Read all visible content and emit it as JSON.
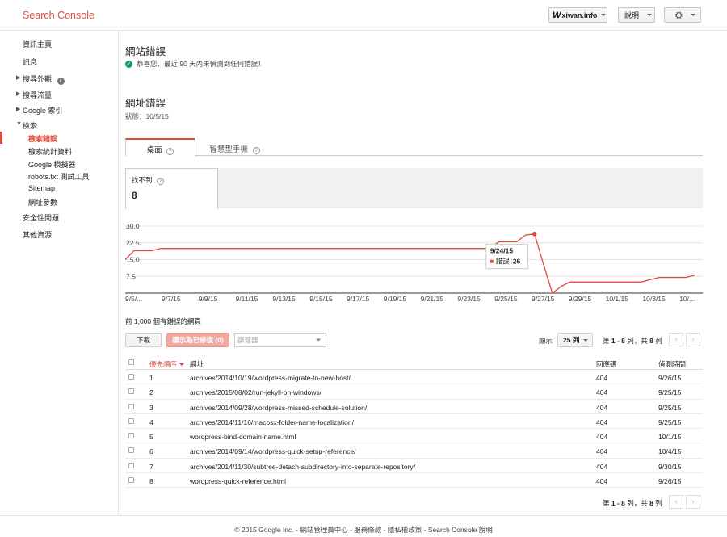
{
  "header": {
    "brand": "Search Console",
    "site": "xiwan.info",
    "site_logo": "W",
    "help": "說明"
  },
  "sidebar": {
    "items": [
      {
        "label": "資訊主頁"
      },
      {
        "label": "訊息"
      },
      {
        "label": "搜尋外觀"
      },
      {
        "label": "搜尋流量"
      },
      {
        "label": "Google 索引"
      },
      {
        "label": "檢索"
      },
      {
        "label": "安全性問題"
      },
      {
        "label": "其他資源"
      }
    ],
    "crawl_sub": [
      {
        "label": "檢索錯誤"
      },
      {
        "label": "檢索統計資料"
      },
      {
        "label": "Google 模擬器"
      },
      {
        "label": "robots.txt 測試工具"
      },
      {
        "label": "Sitemap"
      },
      {
        "label": "網址參數"
      }
    ]
  },
  "site_errors": {
    "title": "網站錯誤",
    "message": "恭喜您，最近 90 天內未偵測到任何錯誤！"
  },
  "url_errors": {
    "title": "網址錯誤",
    "status": "狀態：10/5/15",
    "tabs": [
      {
        "label": "桌面"
      },
      {
        "label": "智慧型手機"
      }
    ],
    "metric_label": "找不到",
    "metric_value": "8"
  },
  "chart_data": {
    "type": "line",
    "color": "#dd4b39",
    "x_labels": [
      "9/5/...",
      "9/7/15",
      "9/9/15",
      "9/11/15",
      "9/13/15",
      "9/15/15",
      "9/17/15",
      "9/19/15",
      "9/21/15",
      "9/23/15",
      "9/25/15",
      "9/27/15",
      "9/29/15",
      "10/1/15",
      "10/3/15",
      "10/..."
    ],
    "y_ticks": [
      "30.0",
      "22.5",
      "15.0",
      "7.5"
    ],
    "ylim": [
      0,
      30
    ],
    "values": [
      15,
      19,
      19,
      19,
      20,
      20,
      20,
      20,
      20,
      20,
      20,
      20,
      20,
      20,
      20,
      20,
      20,
      20,
      20,
      20,
      20,
      20,
      20,
      20,
      20,
      20,
      20,
      20,
      20,
      20,
      20,
      20,
      20,
      20,
      20,
      20,
      20,
      20,
      20,
      20,
      20,
      20,
      23,
      23,
      23,
      26,
      26.5,
      13,
      0,
      3,
      5,
      5,
      5,
      5,
      5,
      5,
      5,
      5,
      5,
      6,
      7,
      7,
      7,
      7,
      8
    ],
    "tooltip": {
      "date": "9/24/15",
      "series": "錯誤：",
      "value": "26"
    }
  },
  "table": {
    "title": "前 1,000 個有錯誤的網頁",
    "download": "下載",
    "mark_fixed": "標示為已修復 (0)",
    "filter_placeholder": "篩選器",
    "show_label": "顯示",
    "rows_per_page": "25 列",
    "page_info_prefix": "第 ",
    "page_range": "1 - 8",
    "page_info_mid": " 列，共 ",
    "page_total": "8",
    "page_info_suffix": " 列",
    "columns": {
      "priority": "優先順序",
      "url": "網址",
      "code": "回應碼",
      "detected": "偵測時間"
    },
    "rows": [
      {
        "priority": "1",
        "url": "archives/2014/10/19/wordpress-migrate-to-new-host/",
        "code": "404",
        "detected": "9/26/15"
      },
      {
        "priority": "2",
        "url": "archives/2015/08/02/run-jekyll-on-windows/",
        "code": "404",
        "detected": "9/25/15"
      },
      {
        "priority": "3",
        "url": "archives/2014/09/28/wordpress-missed-schedule-solution/",
        "code": "404",
        "detected": "9/25/15"
      },
      {
        "priority": "4",
        "url": "archives/2014/11/16/macosx-folder-name-localization/",
        "code": "404",
        "detected": "9/25/15"
      },
      {
        "priority": "5",
        "url": "wordpress-bind-domain-name.html",
        "code": "404",
        "detected": "10/1/15"
      },
      {
        "priority": "6",
        "url": "archives/2014/09/14/wordpress-quick-setup-reference/",
        "code": "404",
        "detected": "10/4/15"
      },
      {
        "priority": "7",
        "url": "archives/2014/11/30/subtree-detach-subdirectory-into-separate-repository/",
        "code": "404",
        "detected": "9/30/15"
      },
      {
        "priority": "8",
        "url": "wordpress-quick-reference.html",
        "code": "404",
        "detected": "9/26/15"
      }
    ]
  },
  "footer": "© 2015 Google Inc. - 網站管理員中心 - 服務條款 - 隱私權政策 - Search Console 說明"
}
